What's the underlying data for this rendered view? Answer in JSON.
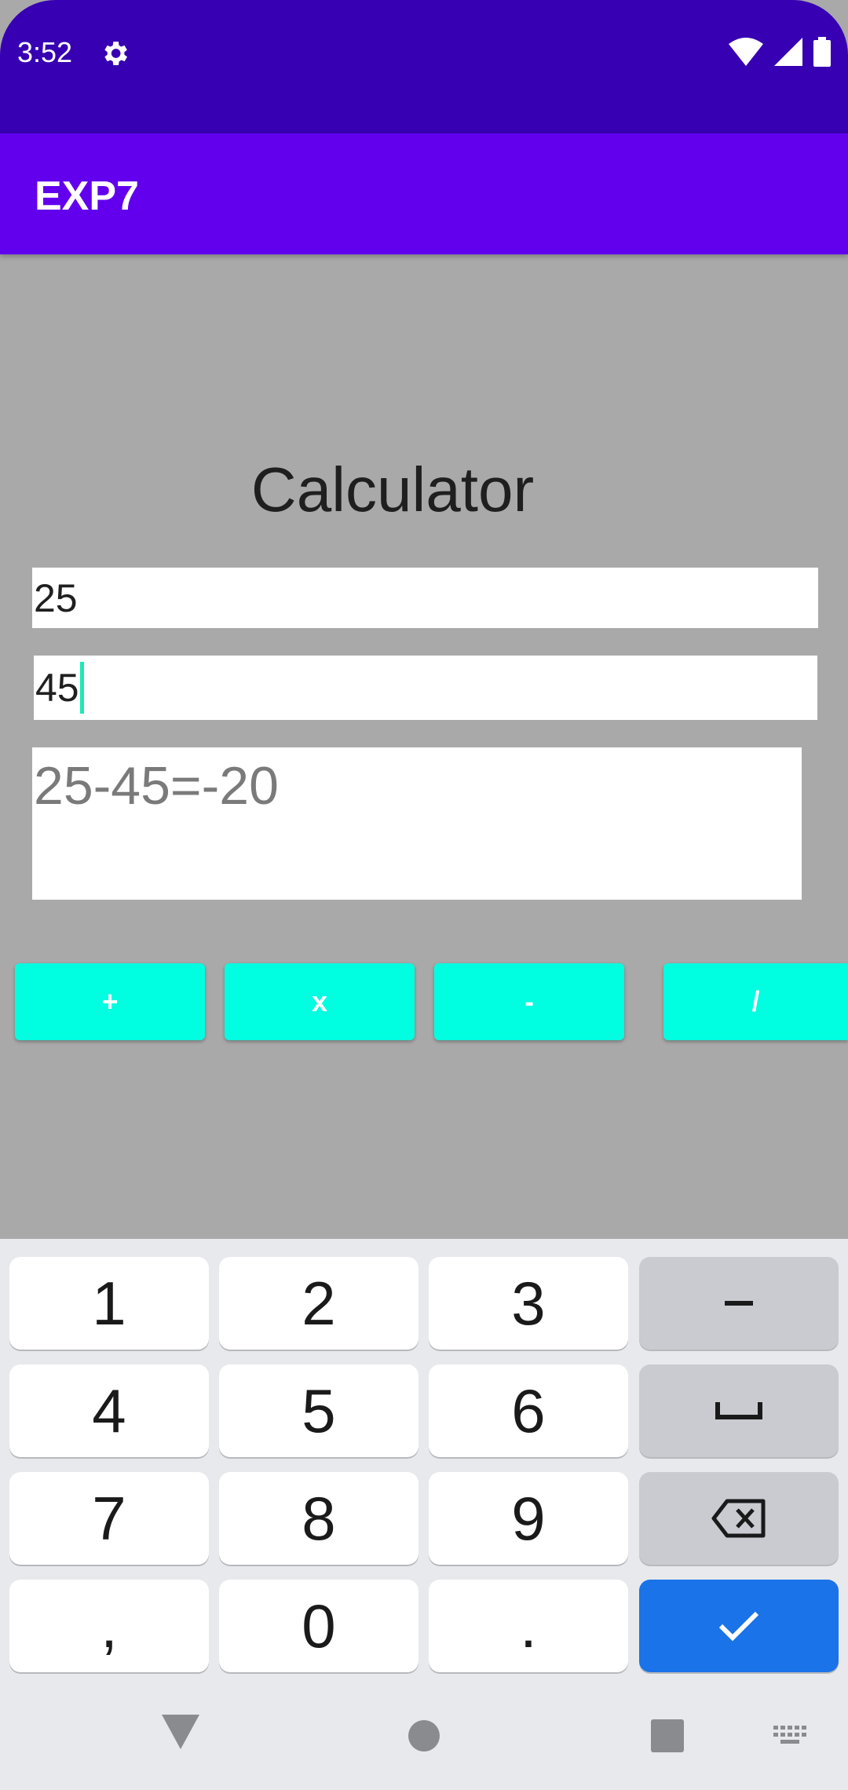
{
  "status": {
    "time": "3:52"
  },
  "app": {
    "title": "EXP7"
  },
  "main": {
    "heading": "Calculator",
    "first_number": "25",
    "second_number": "45",
    "result": "25-45=-20"
  },
  "operators": {
    "add": "+",
    "multiply": "x",
    "subtract": "-",
    "divide": "/"
  },
  "keyboard": {
    "keys": [
      "1",
      "2",
      "3",
      "4",
      "5",
      "6",
      "7",
      "8",
      "9",
      ",",
      "0",
      "."
    ]
  },
  "colors": {
    "status_bar": "#3700b3",
    "app_bar": "#6200ee",
    "button": "#00ffe0",
    "background": "#a9a9a9",
    "cursor": "#1de9b6",
    "enter_key": "#1a73e8"
  }
}
